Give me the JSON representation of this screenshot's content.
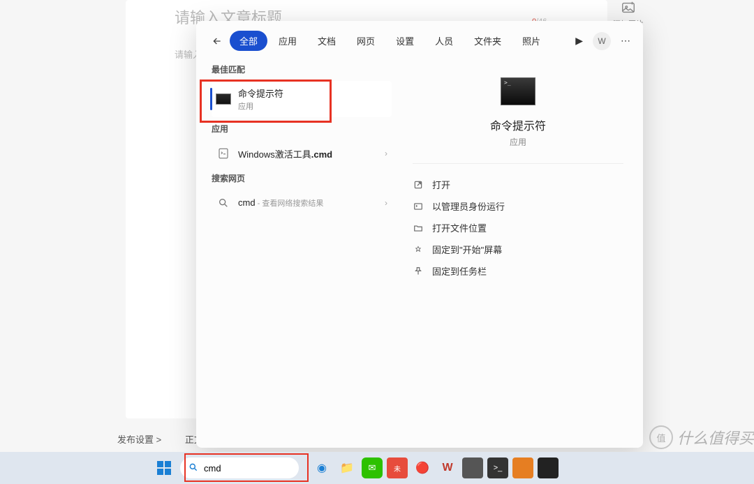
{
  "editor": {
    "title_placeholder": "请输入文章标题",
    "counter_cur": "0",
    "counter_max": "/46",
    "body_placeholder": "请输入",
    "add_image": "添加图片",
    "footer_publish": "发布设置 >",
    "footer_body": "正文"
  },
  "panel": {
    "tabs": [
      "全部",
      "应用",
      "文档",
      "网页",
      "设置",
      "人员",
      "文件夹",
      "照片"
    ],
    "avatar_letter": "W",
    "sections": {
      "best_match": "最佳匹配",
      "apps": "应用",
      "web": "搜索网页"
    },
    "best_match": {
      "title": "命令提示符",
      "sub": "应用"
    },
    "app_result": {
      "prefix": "Windows激活工具",
      "bold": ".cmd"
    },
    "web_result": {
      "query": "cmd",
      "hint": " - 查看网络搜索结果"
    },
    "preview": {
      "title": "命令提示符",
      "sub": "应用"
    },
    "actions": [
      "打开",
      "以管理员身份运行",
      "打开文件位置",
      "固定到\"开始\"屏幕",
      "固定到任务栏"
    ]
  },
  "taskbar": {
    "search_value": "cmd"
  },
  "watermark": {
    "badge": "值",
    "text": "什么值得买"
  }
}
